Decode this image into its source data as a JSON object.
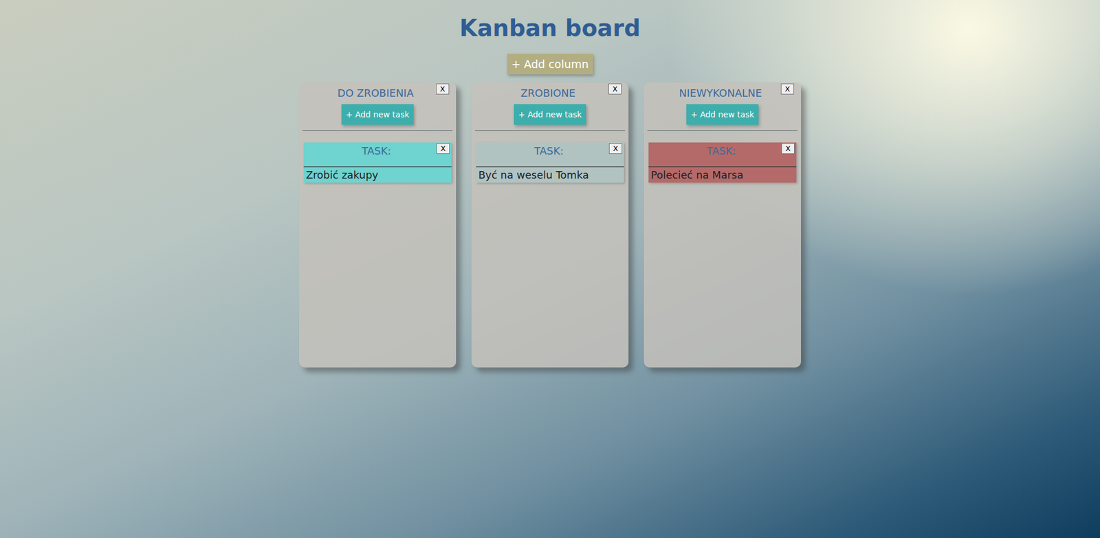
{
  "title": "Kanban board",
  "add_column": "+ Add column",
  "columns": [
    {
      "name": "DO ZROBIENIA",
      "close": "X",
      "add_task": "+ Add new task",
      "tasks": [
        {
          "label": "TASK:",
          "close": "X",
          "text": "Zrobić zakupy",
          "color": "#6fd3cf"
        }
      ]
    },
    {
      "name": "ZROBIONE",
      "close": "X",
      "add_task": "+ Add new task",
      "tasks": [
        {
          "label": "TASK:",
          "close": "X",
          "text": "Być na weselu Tomka",
          "color": "#b1c3c1"
        }
      ]
    },
    {
      "name": "NIEWYKONALNE",
      "close": "X",
      "add_task": "+ Add new task",
      "tasks": [
        {
          "label": "TASK:",
          "close": "X",
          "text": "Polecieć na Marsa",
          "color": "#b56a6a"
        }
      ]
    }
  ]
}
